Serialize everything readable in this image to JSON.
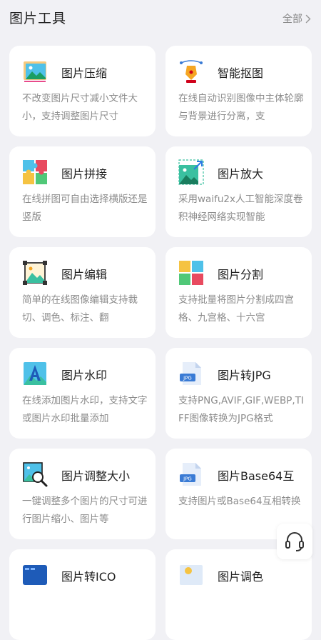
{
  "header": {
    "title": "图片工具",
    "see_all": "全部"
  },
  "tools": [
    {
      "title": "图片压缩",
      "desc": "不改变图片尺寸减小文件大小，支持调整图片尺寸",
      "icon": "image-compress-icon"
    },
    {
      "title": "智能抠图",
      "desc": "在线自动识别图像中主体轮廓与背景进行分离，支",
      "icon": "pen-nib-icon"
    },
    {
      "title": "图片拼接",
      "desc": "在线拼图可自由选择横版还是竖版",
      "icon": "puzzle-icon"
    },
    {
      "title": "图片放大",
      "desc": "采用waifu2x人工智能深度卷积神经网络实现智能",
      "icon": "image-enlarge-icon"
    },
    {
      "title": "图片编辑",
      "desc": "简单的在线图像编辑支持裁切、调色、标注、翻",
      "icon": "image-edit-icon"
    },
    {
      "title": "图片分割",
      "desc": "支持批量将图片分割成四宫格、九宫格、十六宫",
      "icon": "image-split-icon"
    },
    {
      "title": "图片水印",
      "desc": "在线添加图片水印，支持文字或图片水印批量添加",
      "icon": "watermark-icon"
    },
    {
      "title": "图片转JPG",
      "desc": "支持PNG,AVIF,GIF,WEBP,TIFF图像转换为JPG格式",
      "icon": "jpg-file-icon",
      "badge": "JPG"
    },
    {
      "title": "图片调整大小",
      "desc": "一键调整多个图片的尺寸可进行图片缩小、图片等",
      "icon": "image-resize-icon"
    },
    {
      "title": "图片Base64互",
      "desc": "支持图片或Base64互相转换",
      "icon": "jpg-file-icon",
      "badge": "JPG"
    },
    {
      "title": "图片转ICO",
      "desc": "",
      "icon": "image-ico-icon"
    },
    {
      "title": "图片调色",
      "desc": "",
      "icon": "image-color-icon"
    }
  ]
}
